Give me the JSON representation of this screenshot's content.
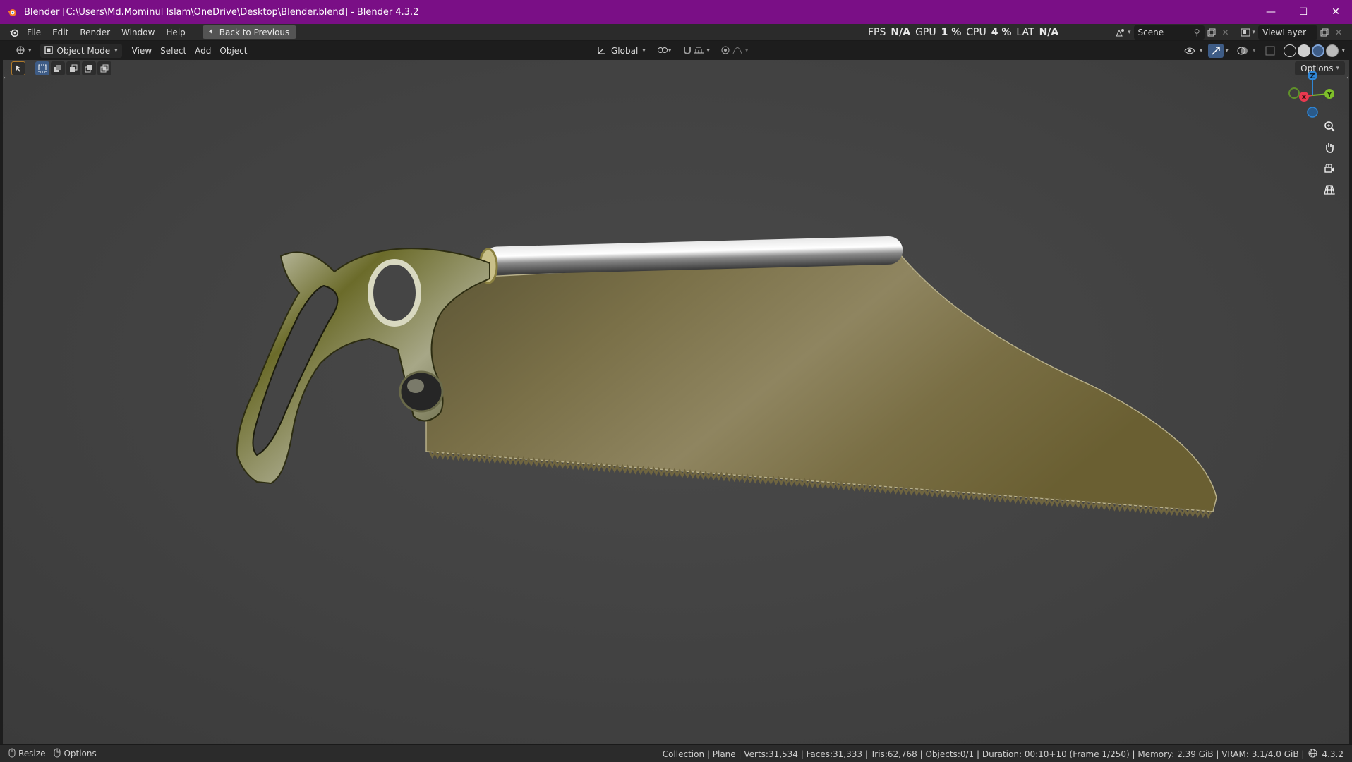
{
  "window": {
    "title": "Blender [C:\\Users\\Md.Mominul Islam\\OneDrive\\Desktop\\Blender.blend] - Blender 4.3.2",
    "controls": {
      "minimize": "—",
      "maximize": "☐",
      "close": "✕"
    }
  },
  "topbar": {
    "menus": [
      "File",
      "Edit",
      "Render",
      "Window",
      "Help"
    ],
    "back_label": "Back to Previous",
    "perf": {
      "fps_label": "FPS",
      "fps_value": "N/A",
      "gpu_label": "GPU",
      "gpu_value": "1 %",
      "cpu_label": "CPU",
      "cpu_value": "4 %",
      "lat_label": "LAT",
      "lat_value": "N/A"
    },
    "scene": "Scene",
    "view_layer": "ViewLayer"
  },
  "viewport_header": {
    "mode": "Object Mode",
    "menus": [
      "View",
      "Select",
      "Add",
      "Object"
    ],
    "transform_orientation": "Global",
    "options": "Options"
  },
  "gizmo": {
    "z": "Z",
    "y": "Y",
    "x": "X"
  },
  "statusbar": {
    "left": [
      "Resize",
      "Options"
    ],
    "info": "Collection | Plane | Verts:31,534 | Faces:31,333 | Tris:62,768 | Objects:0/1 | Duration: 00:10+10 (Frame 1/250) | Memory: 2.39 GiB | VRAM: 3.1/4.0 GiB |",
    "version": "4.3.2"
  },
  "colors": {
    "titlebar": "#7a0f86",
    "axis_x": "#e8394f",
    "axis_y": "#7fbf2a",
    "axis_z": "#2f86d6",
    "active_tool": "#3e5c86"
  }
}
